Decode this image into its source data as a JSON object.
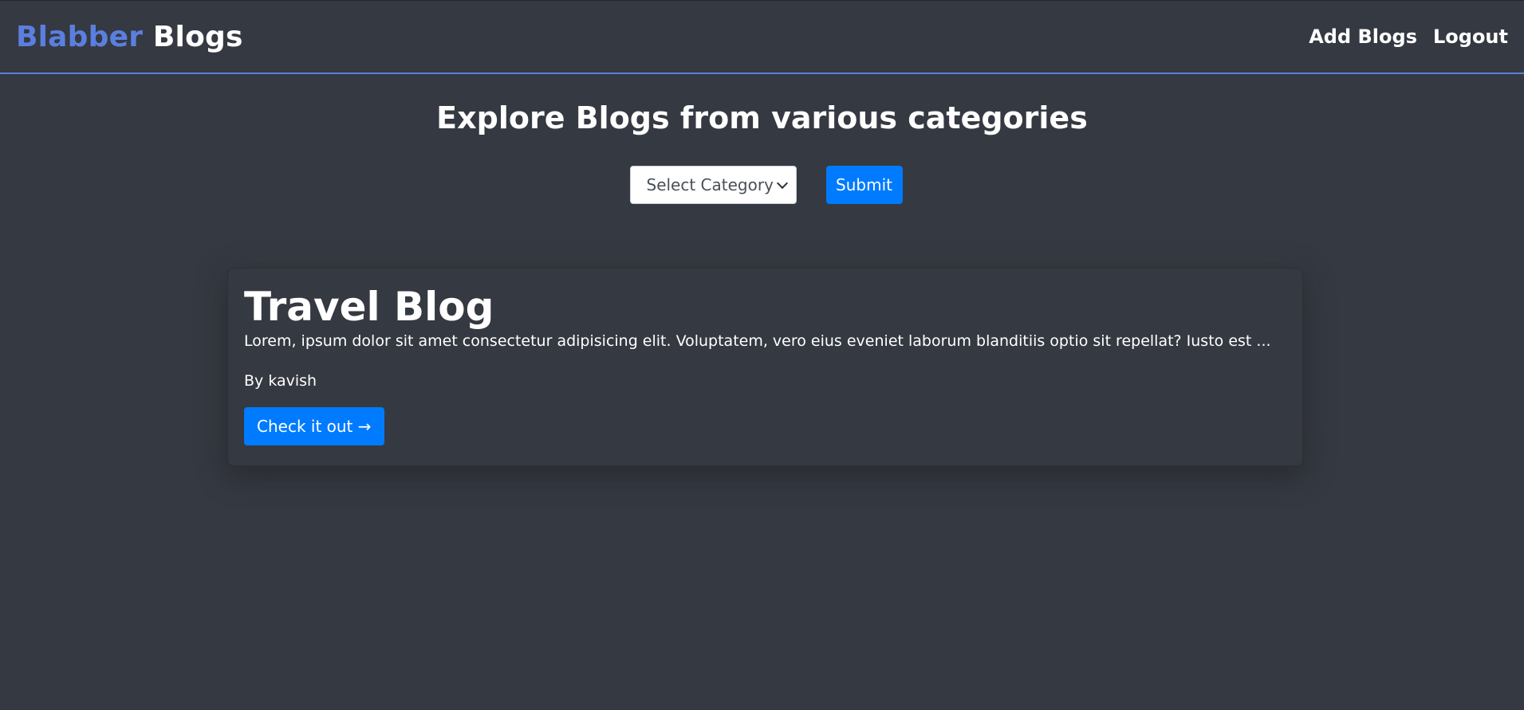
{
  "navbar": {
    "brand_accent": "Blabber",
    "brand_rest": "Blogs",
    "links": [
      "Add Blogs",
      "Logout"
    ]
  },
  "main": {
    "headline": "Explore Blogs from various categories",
    "filter": {
      "select_value": "Select Category",
      "submit_label": "Submit"
    }
  },
  "posts": [
    {
      "title": "Travel Blog",
      "excerpt": "Lorem, ipsum dolor sit amet consectetur adipisicing elit. Voluptatem, vero eius eveniet laborum blanditiis optio sit repellat? Iusto est ...",
      "author": "By kavish",
      "cta": "Check it out →"
    }
  ],
  "colors": {
    "background": "#353941",
    "accent": "#5b7fe0",
    "primary_button": "#007bff"
  }
}
